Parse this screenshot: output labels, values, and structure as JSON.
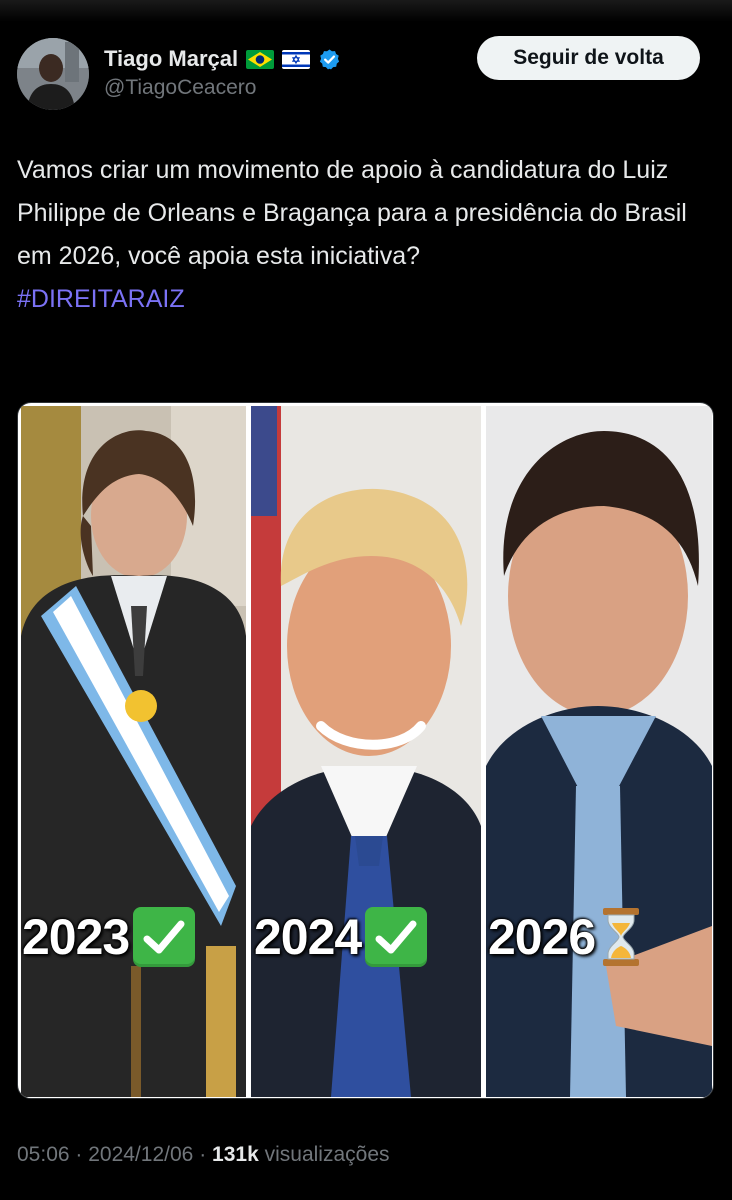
{
  "author": {
    "display_name": "Tiago Marçal",
    "handle": "@TiagoCeacero",
    "flags": [
      "brazil-flag",
      "israel-flag"
    ],
    "verified": true
  },
  "follow_button": {
    "label": "Seguir de volta"
  },
  "tweet": {
    "text": "Vamos criar um movimento de apoio à candidatura do Luiz Philippe de Orleans e Bragança para a presidência do Brasil em 2026, você apoia esta iniciativa?",
    "hashtag": "#DIREITARAIZ"
  },
  "media": {
    "panels": [
      {
        "year": "2023",
        "status_icon": "check-mark-icon"
      },
      {
        "year": "2024",
        "status_icon": "check-mark-icon"
      },
      {
        "year": "2026",
        "status_icon": "hourglass-icon"
      }
    ]
  },
  "meta": {
    "time": "05:06",
    "date": "2024/12/06",
    "views_count": "131k",
    "views_label": "visualizações",
    "separator": "·"
  },
  "colors": {
    "background": "#000000",
    "text": "#e7e9ea",
    "secondary_text": "#71767b",
    "hashtag": "#7b72f5",
    "verified": "#1d9bf0",
    "check": "#3eb547"
  }
}
